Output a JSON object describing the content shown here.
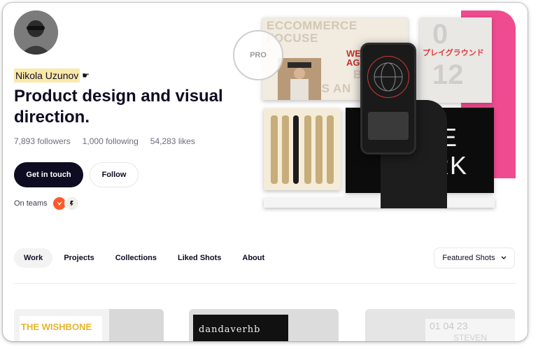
{
  "profile": {
    "name": "Nikola Uzunov",
    "headline": "Product design and visual direction.",
    "stats": {
      "followers": "7,893 followers",
      "following": "1,000 following",
      "likes": "54,283 likes"
    },
    "primary_button": "Get in touch",
    "follow_button": "Follow",
    "teams_label": "On teams"
  },
  "hero": {
    "stamp_text": "PRO",
    "tile_eco_lines": [
      "ECCOMMERCE",
      "FOCUSE",
      "BA",
      "LOS AN"
    ],
    "tile_eco_red": "WEB DEVEL AGENC",
    "tile_jp_text": "プレイグラウンド",
    "tile_jp_num": "12",
    "tile_dark_lines": [
      "TIME",
      "WORK"
    ]
  },
  "tabs": [
    {
      "label": "Work",
      "active": true
    },
    {
      "label": "Projects",
      "active": false
    },
    {
      "label": "Collections",
      "active": false
    },
    {
      "label": "Liked Shots",
      "active": false
    },
    {
      "label": "About",
      "active": false
    }
  ],
  "sort": {
    "label": "Featured Shots"
  },
  "shots": [
    {
      "title": "THE WISHBONE"
    },
    {
      "title": "dandaverhb"
    },
    {
      "title": "01 04 23",
      "subtitle": "STEVEN"
    }
  ],
  "colors": {
    "accent_pink": "#ee4b90",
    "dark": "#0d0c22",
    "name_highlight": "#fbe9a9",
    "team_orange": "#ff5a2d"
  }
}
